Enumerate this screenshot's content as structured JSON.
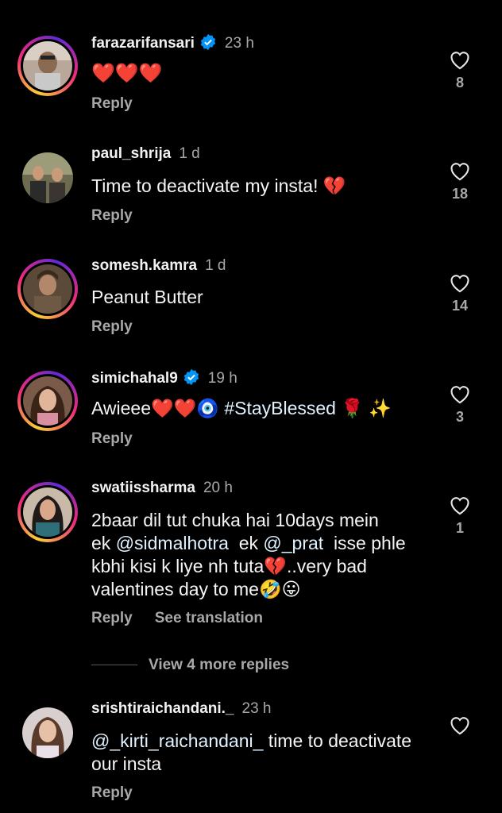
{
  "comments": [
    {
      "username": "farazarifansari",
      "verified": true,
      "time": "23 h",
      "text": "❤️❤️❤️",
      "likes": "8",
      "reply": "Reply",
      "story_ring": true
    },
    {
      "username": "paul_shrija",
      "verified": false,
      "time": "1 d",
      "text": "Time to deactivate my insta! 💔",
      "likes": "18",
      "reply": "Reply",
      "story_ring": false
    },
    {
      "username": "somesh.kamra",
      "verified": false,
      "time": "1 d",
      "text": "Peanut Butter",
      "likes": "14",
      "reply": "Reply",
      "story_ring": true
    },
    {
      "username": "simichahal9",
      "verified": true,
      "time": "19 h",
      "text_plain": "Awieee❤️❤️🧿 ",
      "hashtag": "#StayBlessed",
      "text_tail": " 🌹 ✨",
      "likes": "3",
      "reply": "Reply",
      "story_ring": true
    },
    {
      "username": "swatiissharma",
      "verified": false,
      "time": "20 h",
      "line1": "2baar dil tut chuka hai 10days mein",
      "line2_pre": "ek ",
      "mention1": "@sidmalhotra",
      "line2_mid": "  ek ",
      "mention2": "@_prat",
      "line2_post": "  isse phle",
      "line3": "kbhi kisi k liye nh tuta💔..very bad",
      "line4": "valentines day to me🤣😛",
      "likes": "1",
      "reply": "Reply",
      "see_translation": "See translation",
      "story_ring": true
    },
    {
      "username": "srishtiraichandani._",
      "verified": false,
      "time": "23 h",
      "mention": "@_kirti_raichandani_",
      "text_rest": " time to deactivate",
      "line2": "our insta",
      "likes": "",
      "reply": "Reply",
      "story_ring": false
    }
  ],
  "view_more_replies": "View 4 more replies",
  "colors": {
    "background": "#000000",
    "verified": "#0095f6",
    "muted": "#a8a8a8",
    "mention": "#e0f1ff"
  },
  "icons": {
    "like": "heart-outline-icon",
    "verified": "verified-badge-icon"
  }
}
